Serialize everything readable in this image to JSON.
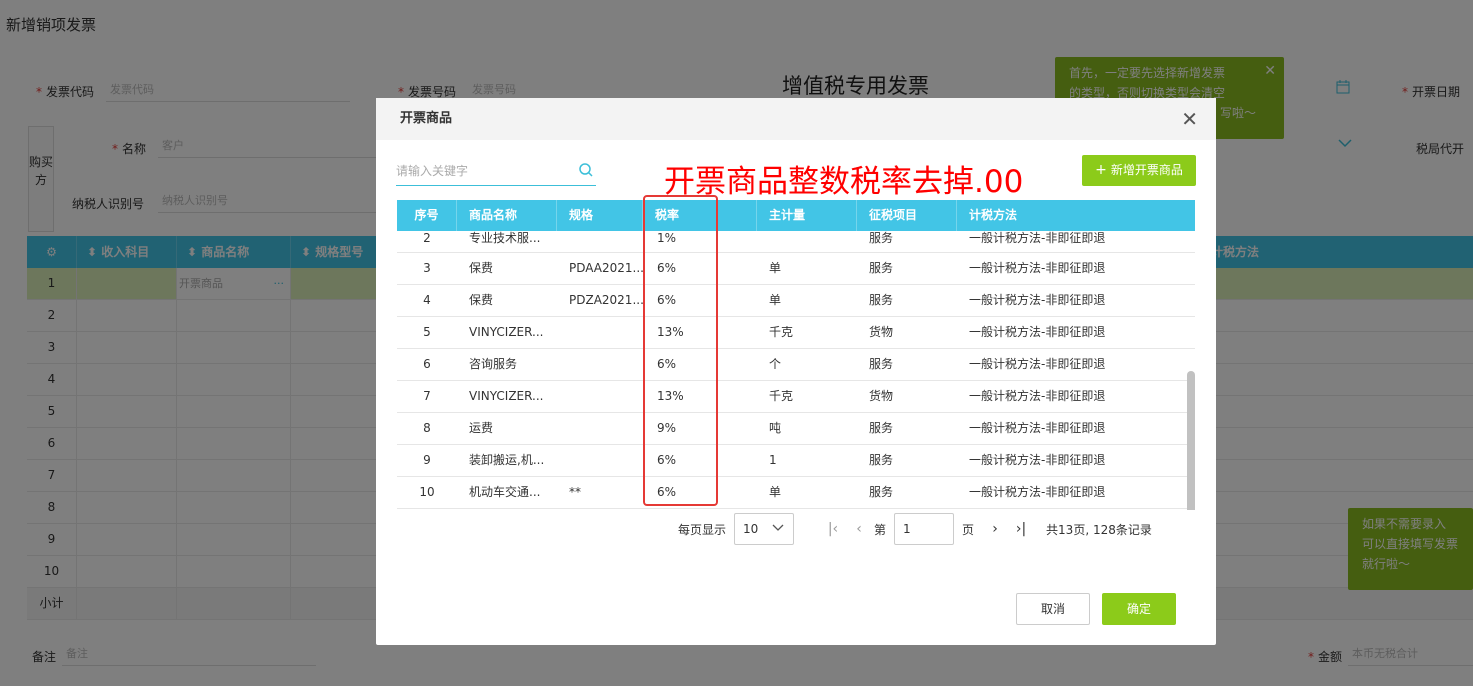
{
  "page": {
    "title": "新增销项发票",
    "invoice_type_title": "增值税专用发票",
    "fields": {
      "invoice_code_label": "发票代码",
      "invoice_code_placeholder": "发票代码",
      "invoice_number_label": "发票号码",
      "invoice_number_placeholder": "发票号码",
      "issue_date_label": "开票日期",
      "name_label": "名称",
      "name_placeholder": "客户",
      "tax_bureau_label": "税局代开",
      "taxpayer_id_label": "纳税人识别号",
      "taxpayer_id_placeholder": "纳税人识别号",
      "remark_label": "备注",
      "remark_placeholder": "备注",
      "amount_label": "金额",
      "amount_placeholder": "本币无税合计"
    },
    "buyer_side_label": "购买方",
    "table_headers": [
      "收入科目",
      "商品名称",
      "规格型号",
      "计税方法"
    ],
    "row1_product_placeholder": "开票商品",
    "row_numbers": [
      "1",
      "2",
      "3",
      "4",
      "5",
      "6",
      "7",
      "8",
      "9",
      "10"
    ],
    "subtotal_label": "小计",
    "tip_top": "首先，一定要先选择新增发票的类型，否则切换类型会清空写啦～",
    "tip_top_line1": "首先，一定要先选择新增发票",
    "tip_top_line2": "的类型，否则切换类型会清空",
    "tip_top_line3": "写啦～",
    "tip_bottom_line1": "如果不需要录入",
    "tip_bottom_line2": "可以直接填写发票",
    "tip_bottom_line3": "就行啦～"
  },
  "modal": {
    "title": "开票商品",
    "search_placeholder": "请输入关键字",
    "annotation": "开票商品整数税率去掉.00",
    "add_button": "新增开票商品",
    "columns": [
      "序号",
      "商品名称",
      "规格",
      "税率",
      "主计量",
      "征税项目",
      "计税方法"
    ],
    "rows": [
      {
        "no": "2",
        "name": "专业技术服...",
        "spec": "",
        "rate": "1%",
        "unit": "",
        "item": "服务",
        "method": "一般计税方法-非即征即退"
      },
      {
        "no": "3",
        "name": "保费",
        "spec": "PDAA2021...",
        "rate": "6%",
        "unit": "单",
        "item": "服务",
        "method": "一般计税方法-非即征即退"
      },
      {
        "no": "4",
        "name": "保费",
        "spec": "PDZA2021...",
        "rate": "6%",
        "unit": "单",
        "item": "服务",
        "method": "一般计税方法-非即征即退"
      },
      {
        "no": "5",
        "name": "VINYCIZER...",
        "spec": "",
        "rate": "13%",
        "unit": "千克",
        "item": "货物",
        "method": "一般计税方法-非即征即退"
      },
      {
        "no": "6",
        "name": "咨询服务",
        "spec": "",
        "rate": "6%",
        "unit": "个",
        "item": "服务",
        "method": "一般计税方法-非即征即退"
      },
      {
        "no": "7",
        "name": "VINYCIZER...",
        "spec": "",
        "rate": "13%",
        "unit": "千克",
        "item": "货物",
        "method": "一般计税方法-非即征即退"
      },
      {
        "no": "8",
        "name": "运费",
        "spec": "",
        "rate": "9%",
        "unit": "吨",
        "item": "服务",
        "method": "一般计税方法-非即征即退"
      },
      {
        "no": "9",
        "name": "装卸搬运,机...",
        "spec": "",
        "rate": "6%",
        "unit": "1",
        "item": "服务",
        "method": "一般计税方法-非即征即退"
      },
      {
        "no": "10",
        "name": "机动车交通...",
        "spec": "**",
        "rate": "6%",
        "unit": "单",
        "item": "服务",
        "method": "一般计税方法-非即征即退"
      }
    ],
    "pager": {
      "per_page_label": "每页显示",
      "per_page_value": "10",
      "page_prefix": "第",
      "current_page": "1",
      "page_suffix": "页",
      "summary": "共13页, 128条记录"
    },
    "cancel_button": "取消",
    "ok_button": "确定"
  },
  "colors": {
    "header_cyan": "#42c5e6",
    "primary_green": "#8ccb1a",
    "annotation_red": "#e53935"
  }
}
